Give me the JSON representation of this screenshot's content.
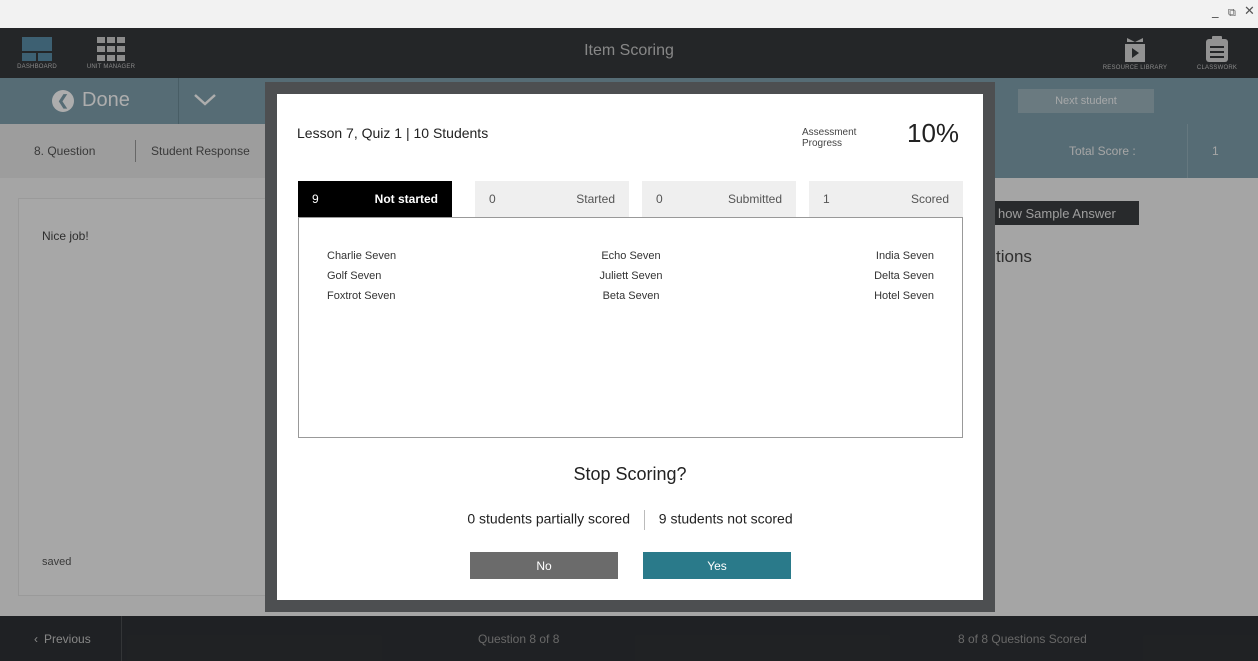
{
  "window": {
    "minimize": "_",
    "restore": "⧉",
    "close": "✕"
  },
  "app": {
    "title": "Item Scoring",
    "nav": {
      "dashboard": "DASHBOARD",
      "unit_manager": "UNIT MANAGER",
      "resource_library": "RESOURCE LIBRARY",
      "classwork": "CLASSWORK"
    }
  },
  "toolbar": {
    "done_label": "Done",
    "next_student": "Next student"
  },
  "question_bar": {
    "question_label": "8.  Question",
    "student_response_tab": "Student Response",
    "total_score_label": "Total Score :",
    "total_score_value": "1"
  },
  "content": {
    "response_text": "Nice job!",
    "saved_status": "saved",
    "sample_answer_button": "how Sample Answer",
    "options_heading": "tions"
  },
  "footer": {
    "previous": "Previous",
    "question_count": "Question 8 of 8",
    "scored_count": "8 of 8 Questions Scored"
  },
  "modal": {
    "title": "Lesson 7, Quiz 1 | 10 Students",
    "progress_label": "Assessment Progress",
    "progress_value": "10%",
    "tabs": [
      {
        "count": "9",
        "label": "Not started"
      },
      {
        "count": "0",
        "label": "Started"
      },
      {
        "count": "0",
        "label": "Submitted"
      },
      {
        "count": "1",
        "label": "Scored"
      }
    ],
    "students": [
      "Charlie Seven",
      "Echo Seven",
      "India Seven",
      "Golf Seven",
      "Juliett Seven",
      "Delta Seven",
      "Foxtrot Seven",
      "Beta Seven",
      "Hotel Seven"
    ],
    "question": "Stop Scoring?",
    "summary_partial": "0 students partially scored",
    "summary_not_scored": "9 students not scored",
    "no_button": "No",
    "yes_button": "Yes"
  },
  "colors": {
    "header_dark": "#35383b",
    "toolbar_teal": "#7fa0ad",
    "yes_button": "#2a7a8a",
    "no_button": "#6b6b6b"
  }
}
